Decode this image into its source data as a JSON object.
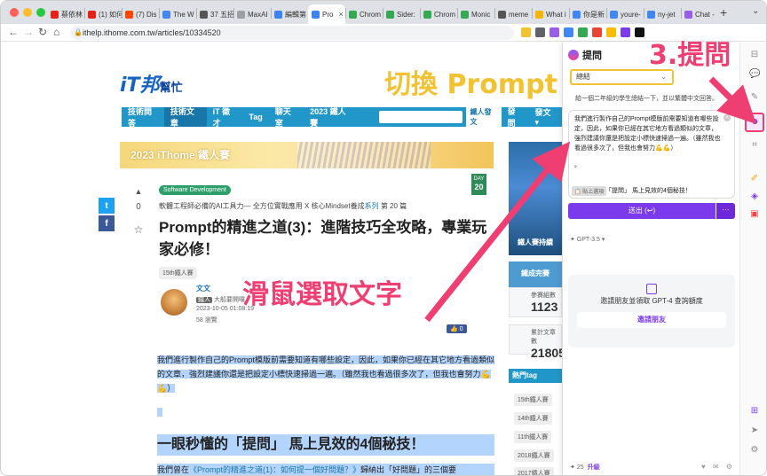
{
  "browser": {
    "tabs": [
      {
        "label": "蔡依林",
        "color": "#e62117"
      },
      {
        "label": "(1) 如何",
        "color": "#e62117"
      },
      {
        "label": "(7) Dis",
        "color": "#ff4500"
      },
      {
        "label": "The W",
        "color": "#4285f4"
      },
      {
        "label": "37 五招",
        "color": "#555555"
      },
      {
        "label": "MaxAI",
        "color": "#9aa0a6"
      },
      {
        "label": "編輯第",
        "color": "#3b82f6"
      },
      {
        "label": "Pro",
        "color": "#3b82f6",
        "active": true
      },
      {
        "label": "Chrom",
        "color": "#34a853"
      },
      {
        "label": "Sider:",
        "color": "#34a853"
      },
      {
        "label": "Chrom",
        "color": "#34a853"
      },
      {
        "label": "Monic",
        "color": "#34a853"
      },
      {
        "label": "meme",
        "color": "#555555"
      },
      {
        "label": "What i",
        "color": "#f4b400"
      },
      {
        "label": "你是新",
        "color": "#4285f4"
      },
      {
        "label": "youre-",
        "color": "#4285f4"
      },
      {
        "label": "ny-jet",
        "color": "#4285f4"
      },
      {
        "label": "Chat -",
        "color": "#9b5de5"
      }
    ],
    "tab_close": "×",
    "new_tab": "+",
    "url": "ithelp.ithome.com.tw/articles/10334520"
  },
  "site": {
    "logo_main": "iT邦",
    "logo_sub": "幫忙",
    "nav": [
      "技術問答",
      "技術文章",
      "iT 徵才",
      "Tag",
      "聊天室",
      "2023 鐵人賽"
    ],
    "nav_active": "技術文章",
    "post_button": "鐵人發文",
    "nav_right": [
      "發問",
      "發文 ▾"
    ]
  },
  "article": {
    "banner_text": "2023 iThome 鐵人賽",
    "day_label": "DAY",
    "day_number": "20",
    "vote_count": "0",
    "category": "Software Development",
    "series_prefix": "軟體工程師必備的AI工具力— 全方位實戰應用 X 核心Mindset養成",
    "series_link": "系列",
    "series_suffix": "第 20 篇",
    "title": "Prompt的精進之道(3)：進階技巧全攻略，專業玩家必修！",
    "ironman_tag": "15th鐵人賽",
    "author": "文文",
    "author_badge": "鐵人",
    "author_note": "大船要開囉",
    "date": "2023-10-05 01:08:19",
    "views": "58 瀏覽",
    "like": "👍 0",
    "selected_paragraph": "我們進行製作自己的Prompt模版前需要知道有哪些設定，因此，如果你已經在其它地方看過類似的文章，強烈建議你還是把設定小標快速掃過一遍。（雖然我也看過很多次了，但我也會努力💪💪）",
    "heading": "一眼秒懂的「提問」 馬上見效的4個秘技！",
    "para2_prefix": "我們曾在",
    "para2_link": "《Prompt的精進之道(1)：如何提一個好問題？》",
    "para2_suffix": "歸納出「好問題」的三個要"
  },
  "sidebar": {
    "ad_text1": "鐵人賽持續",
    "ad_text2": "鐵成完賽",
    "stats": [
      {
        "label": "參賽組數",
        "value": "1123"
      },
      {
        "label": "累計文章數",
        "value": "21805"
      }
    ],
    "hot_tag_header": "熱門tag",
    "hot_tags": [
      "15th鐵人賽",
      "14th鐵人賽",
      "11th鐵人賽",
      "2018鐵人賽",
      "2017鐵人賽"
    ]
  },
  "annotations": {
    "top_overlay": "切換 Prompt",
    "select_text": "滑鼠選取文字",
    "step3": "3.提問"
  },
  "panel": {
    "title": "提問",
    "mode_select": "總結",
    "prompt_line": "給一個二年級的學生總結一下，並以繁體中文回答。",
    "input_text": "我們進行製作自己的Prompt模版前需要知道有哪些設定，因此，如果你已經在其它地方看過類似的文章，強烈建議你還是把設定小標快速掃過一遍。（雖然我也看過很多次了，但我也會努力💪💪）",
    "input_dot": "。",
    "chip": "📋 貼上選項",
    "chip_text": "「提問」 馬上見效的4個秘技！",
    "send_button": "送出 (↩)",
    "more_button": "···",
    "model": "✦ GPT-3.5 ▾",
    "invite_text": "邀請朋友並領取 GPT-4 查詢額度",
    "invite_button": "邀請朋友",
    "credits": "✦ 25",
    "upgrade": "升級",
    "footer_icons": "♥ ✉ ⚙"
  },
  "colors": {
    "accent_pink": "#ef3f72",
    "panel_purple": "#7c3aed",
    "site_blue": "#2196c9",
    "highlight": "#f1c232"
  }
}
